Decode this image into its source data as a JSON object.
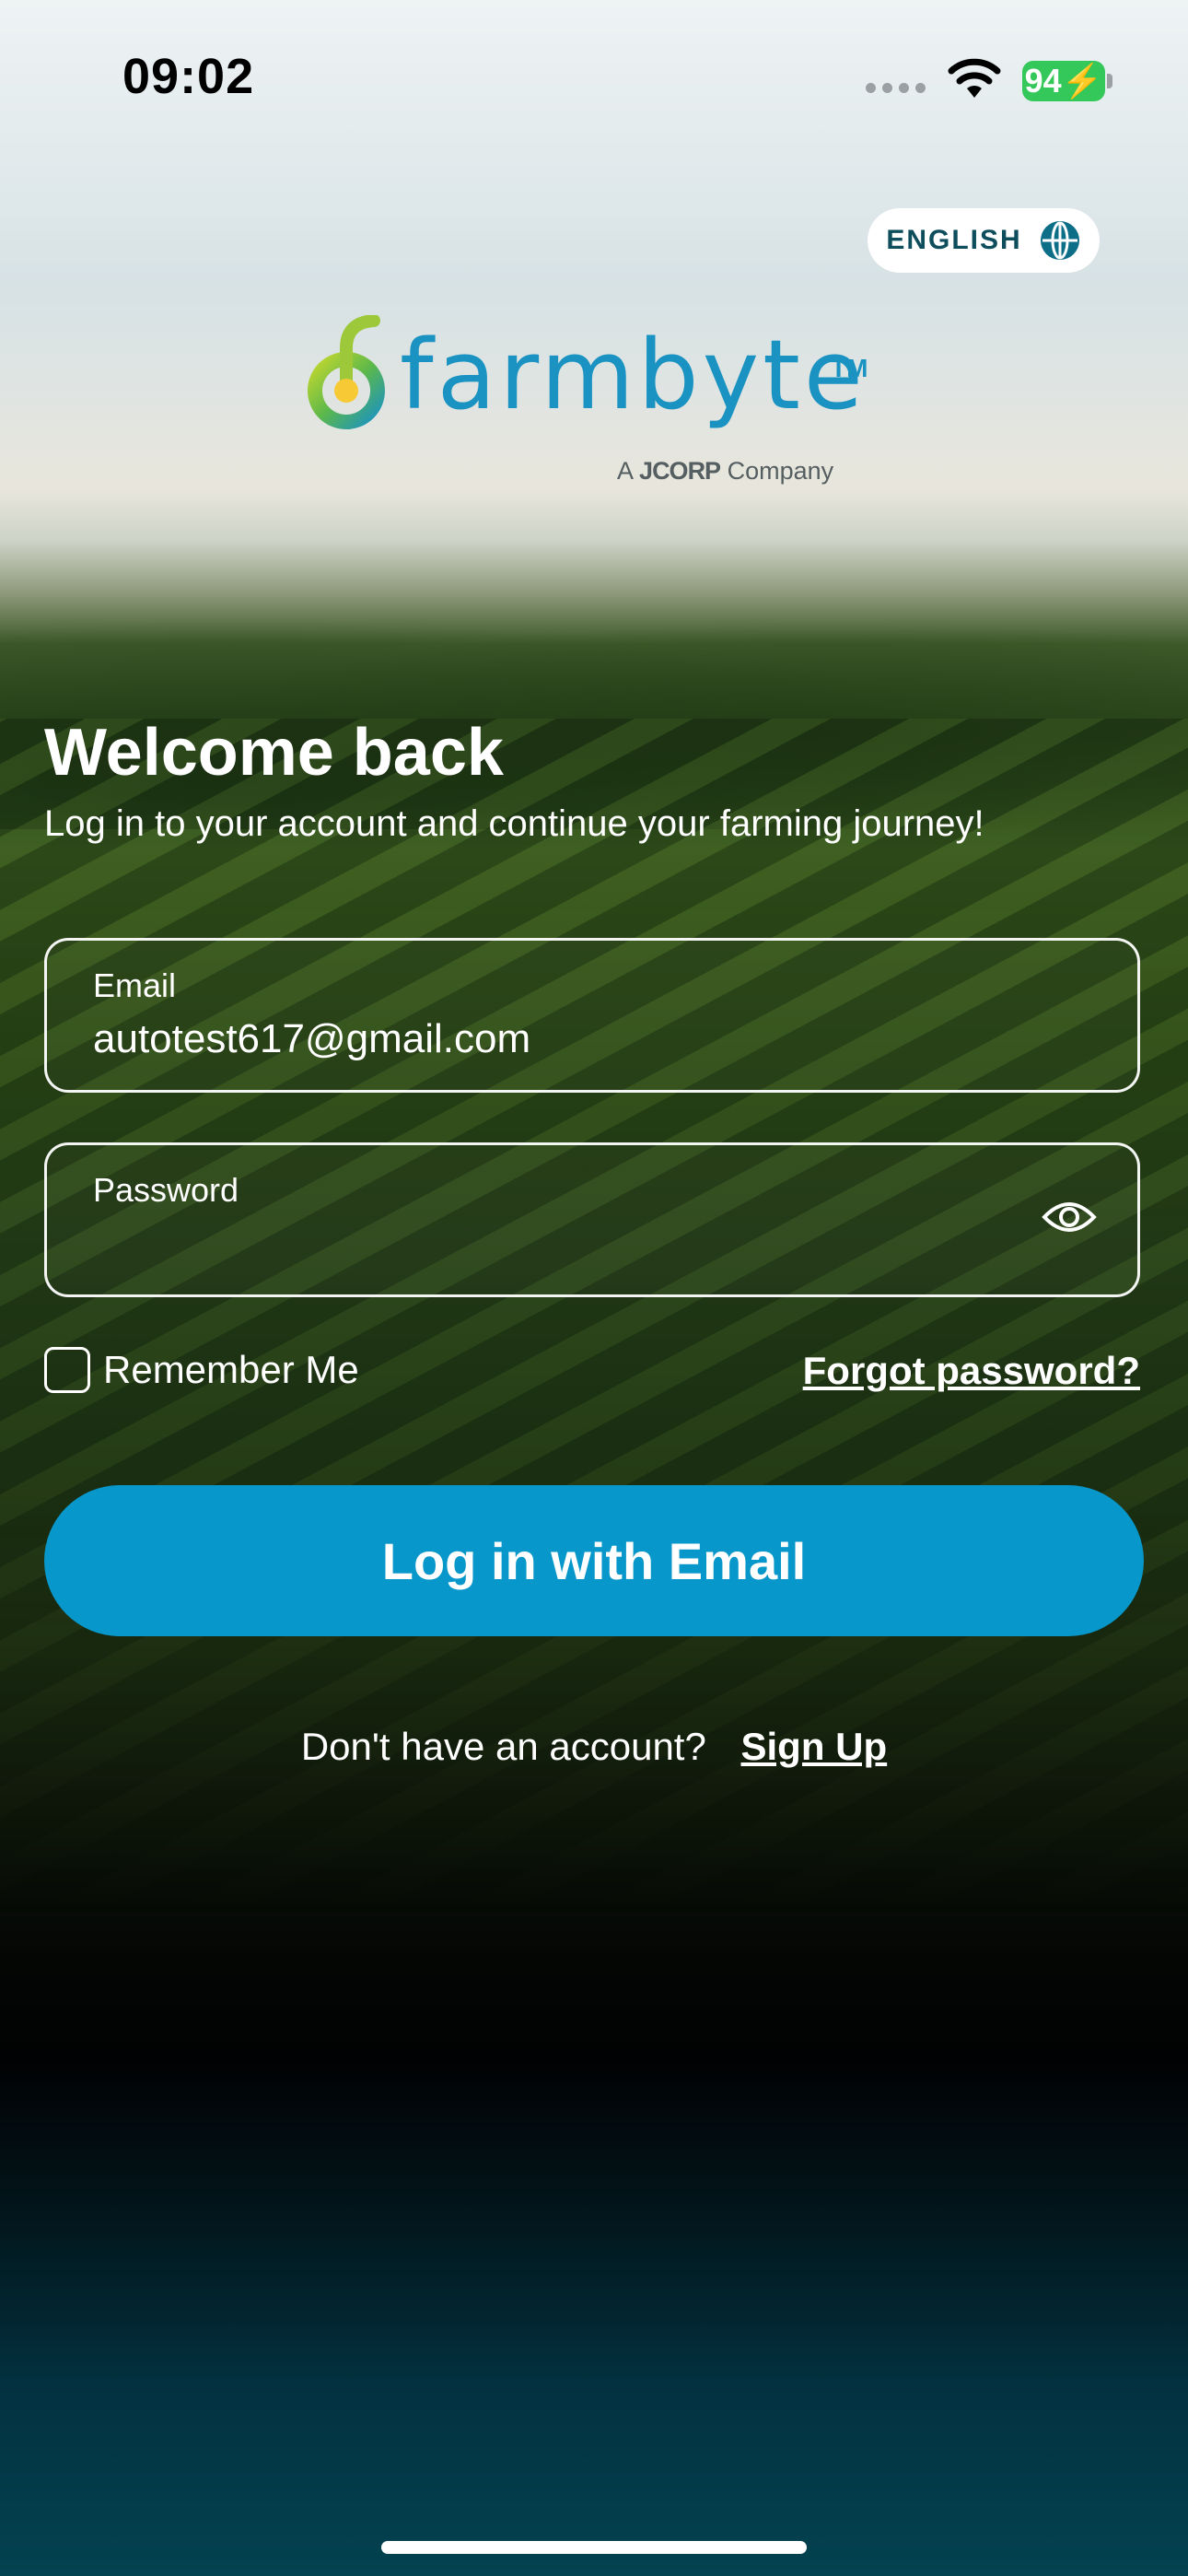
{
  "status_bar": {
    "time": "09:02",
    "battery": "94"
  },
  "language": {
    "label": "ENGLISH"
  },
  "logo": {
    "name": "farmbyte",
    "tm": "TM",
    "company_prefix": "A",
    "company_brand": "JCORP",
    "company_suffix": "Company"
  },
  "heading": {
    "title": "Welcome back",
    "subtitle": "Log in to your account and continue your farming journey!"
  },
  "form": {
    "email_label": "Email",
    "email_value": "autotest617@gmail.com",
    "password_label": "Password",
    "password_value": "",
    "remember_label": "Remember Me",
    "forgot_label": "Forgot password?",
    "login_button": "Log in with Email"
  },
  "signup": {
    "prompt": "Don't have an account?",
    "link": "Sign Up"
  },
  "colors": {
    "primary": "#0797ca",
    "brand_text": "#1a93c2",
    "battery": "#34c759"
  }
}
